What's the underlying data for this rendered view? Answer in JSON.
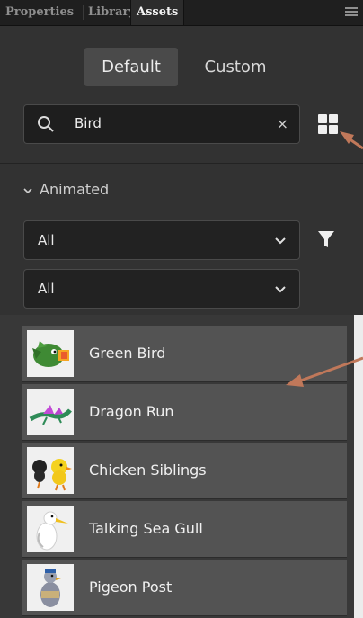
{
  "tabs": [
    {
      "label": "Properties"
    },
    {
      "label": "Library"
    },
    {
      "label": "Assets"
    }
  ],
  "segment": {
    "default": "Default",
    "custom": "Custom"
  },
  "search": {
    "value": "Bird",
    "clear": "×"
  },
  "section": {
    "label": "Animated"
  },
  "filters": {
    "first": "All",
    "second": "All"
  },
  "assets": [
    {
      "name": "Green Bird"
    },
    {
      "name": "Dragon Run"
    },
    {
      "name": "Chicken Siblings"
    },
    {
      "name": "Talking Sea Gull"
    },
    {
      "name": "Pigeon Post"
    }
  ],
  "colors": {
    "annotation": "#c0785a",
    "panel": "#323232",
    "item": "#535353"
  }
}
